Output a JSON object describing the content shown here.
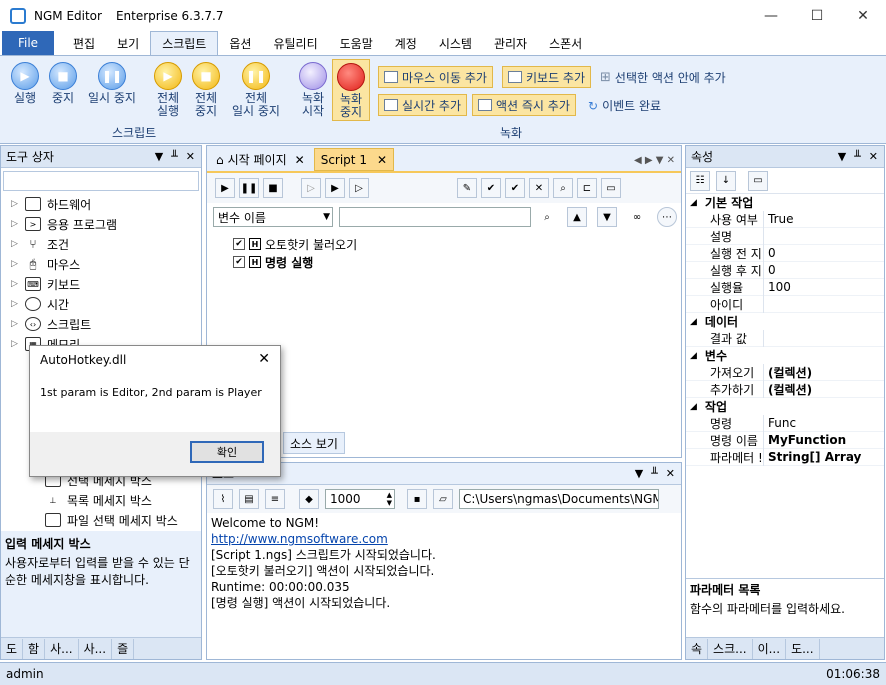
{
  "window": {
    "app": "NGM Editor",
    "edition": "Enterprise 6.3.7.7",
    "min": "—",
    "max": "☐",
    "close": "✕"
  },
  "menu": {
    "file": "File",
    "tabs": [
      "편집",
      "보기",
      "스크립트",
      "옵션",
      "유틸리티",
      "도움말",
      "계정",
      "시스템",
      "관리자",
      "스폰서"
    ],
    "active": "스크립트"
  },
  "ribbon": {
    "script_group": {
      "label": "스크립트",
      "run": "실행",
      "stop": "중지",
      "pause": "일시 중지",
      "run_all": "전체\n실행",
      "stop_all": "전체\n중지",
      "pause_all": "전체\n일시 중지"
    },
    "record_group": {
      "label": "녹화",
      "start": "녹화\n시작",
      "stop": "녹화\n중지",
      "add_mouse": "마우스 이동 추가",
      "add_keyboard": "키보드 추가",
      "inside_action": "선택한 액션 안에 추가",
      "add_realtime": "실시간 추가",
      "add_instant": "액션 즉시 추가",
      "event_done": "이벤트 완료"
    }
  },
  "toolbox": {
    "title": "도구 상자",
    "items": [
      "하드웨어",
      "응용 프로그램",
      "조건",
      "마우스",
      "키보드",
      "시간",
      "스크립트",
      "메모리"
    ],
    "sub_items": [
      "선택 메세지 박스",
      "목록 메세지 박스",
      "파일 선택 메세지 박스"
    ],
    "desc_title": "입력 메세지 박스",
    "desc_text": "사용자로부터 입력를 받을 수 있는 단순한 메세지창을 표시합니다.",
    "tabs": [
      "도",
      "함",
      "사...",
      "사...",
      "즐"
    ]
  },
  "editor": {
    "tabs": [
      {
        "label": "시작 페이지"
      },
      {
        "label": "Script 1"
      }
    ],
    "var_dropdown": "변수 이름",
    "actions": [
      {
        "label": "오토핫키 불러오기",
        "bold": false
      },
      {
        "label": "명령 실행",
        "bold": true
      }
    ],
    "bottom_tabs": [
      "소스 보기"
    ]
  },
  "output": {
    "title": "로그",
    "count": "1000",
    "path": "C:\\Users\\ngmas\\Documents\\NGM6\\",
    "lines": [
      {
        "text": "Welcome to NGM!",
        "link": false
      },
      {
        "text": "http://www.ngmsoftware.com",
        "link": true
      },
      {
        "text": "[Script 1.ngs] 스크립트가 시작되었습니다.",
        "link": false
      },
      {
        "text": "[오토핫키 불러오기] 액션이 시작되었습니다.",
        "link": false
      },
      {
        "text": "Runtime: 00:00:00.035",
        "link": false
      },
      {
        "text": "[명령 실행] 액션이 시작되었습니다.",
        "link": false
      }
    ]
  },
  "properties": {
    "title": "속성",
    "categories": [
      {
        "name": "기본 작업",
        "rows": [
          [
            "사용 여부",
            "True"
          ],
          [
            "설명",
            ""
          ],
          [
            "실행 전 지",
            "0"
          ],
          [
            "실행 후 지",
            "0"
          ],
          [
            "실행율",
            "100"
          ],
          [
            "아이디",
            ""
          ]
        ]
      },
      {
        "name": "데이터",
        "rows": [
          [
            "결과 값",
            ""
          ]
        ]
      },
      {
        "name": "변수",
        "rows": [
          [
            "가져오기",
            "(컬렉션)"
          ],
          [
            "추가하기",
            "(컬렉션)"
          ]
        ]
      },
      {
        "name": "작업",
        "rows": [
          [
            "명령",
            "Func"
          ],
          [
            "명령 이름",
            "MyFunction"
          ],
          [
            "파라메터 !",
            "String[] Array"
          ]
        ]
      }
    ],
    "desc_title": "파라메터 목록",
    "desc_text": "함수의 파라메터를 입력하세요.",
    "tabs": [
      "속",
      "스크...",
      "이...",
      "도..."
    ]
  },
  "dialog": {
    "title": "AutoHotkey.dll",
    "message": "1st param is Editor, 2nd param is Player",
    "ok": "확인"
  },
  "status": {
    "user": "admin",
    "time": "01:06:38"
  }
}
